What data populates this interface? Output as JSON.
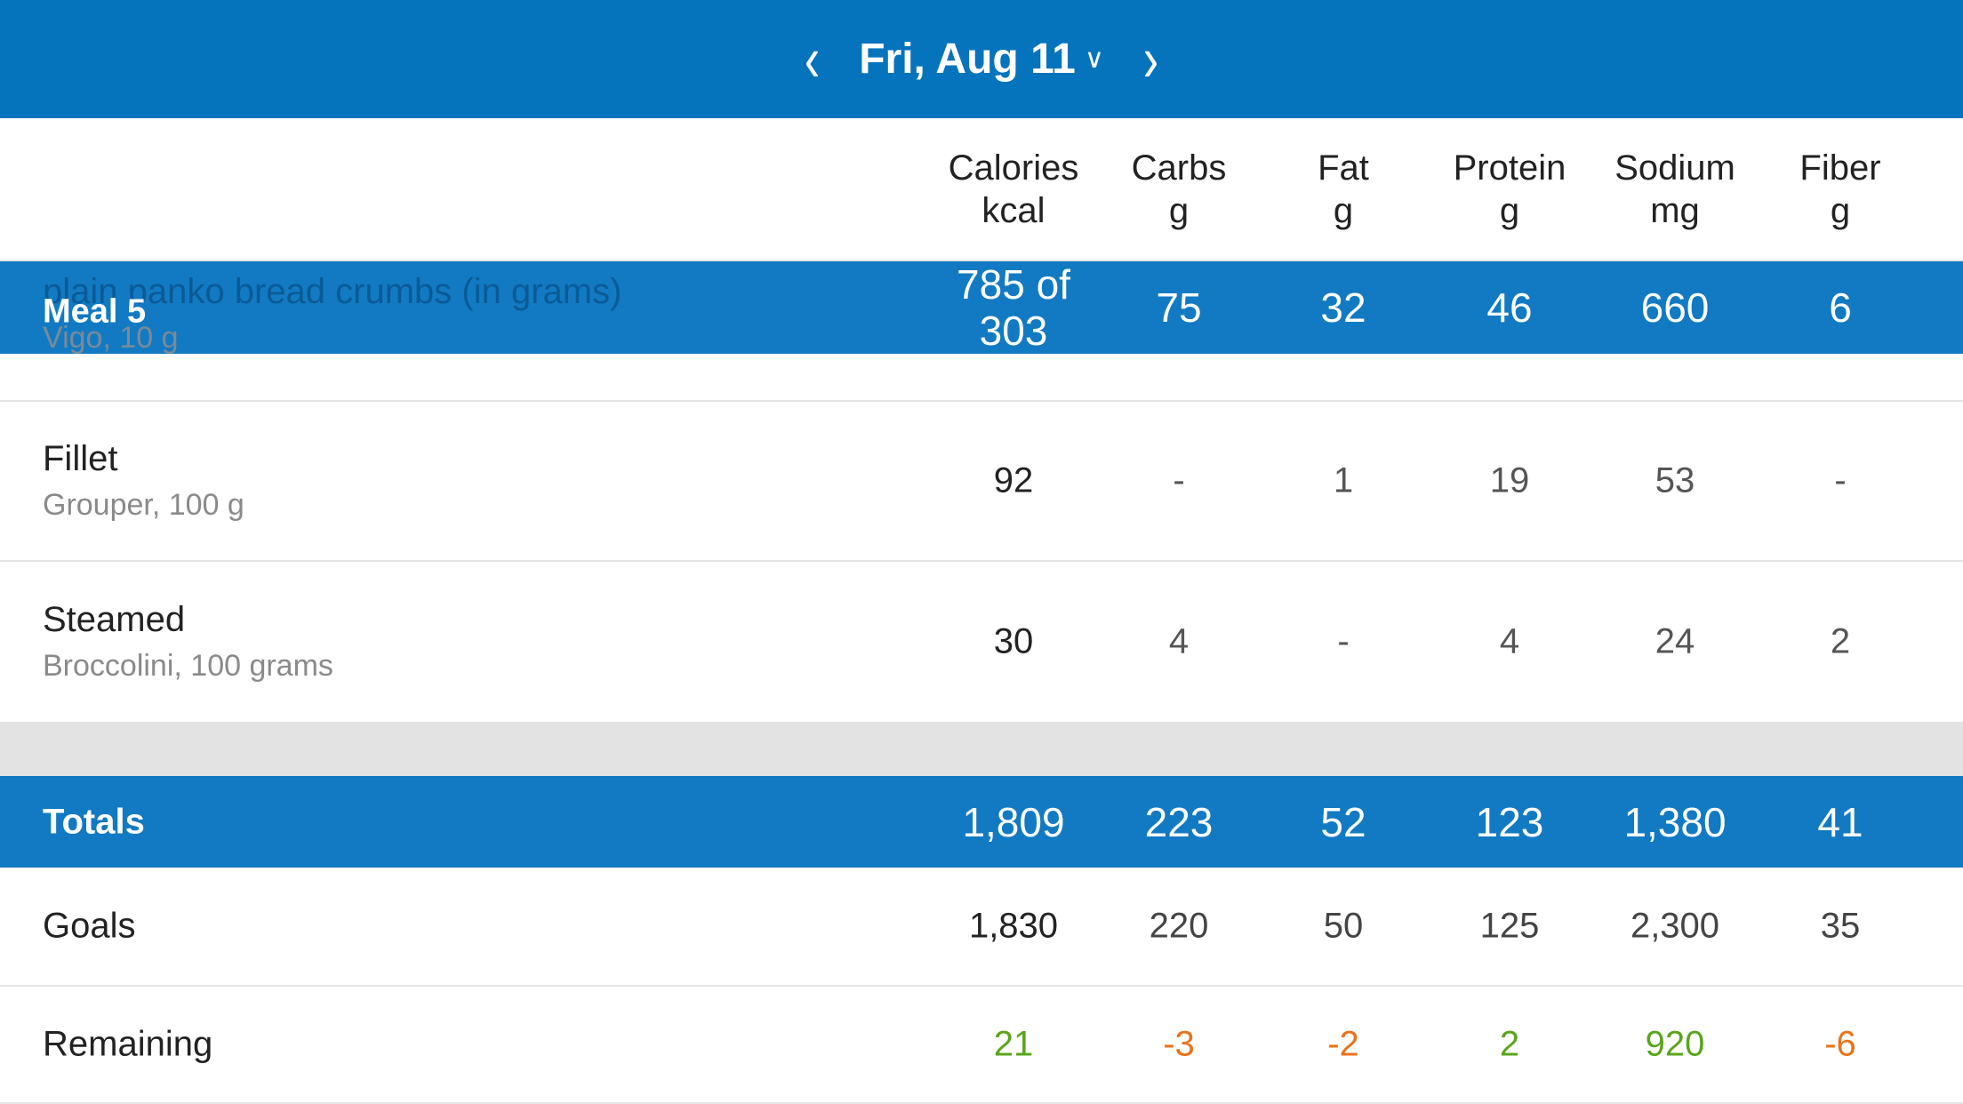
{
  "header": {
    "date": "Fri, Aug 11",
    "prev_icon": "chevron-left-icon",
    "next_icon": "chevron-right-icon",
    "dropdown_icon": "chevron-down-icon"
  },
  "columns": [
    {
      "name": "Calories",
      "unit": "kcal"
    },
    {
      "name": "Carbs",
      "unit": "g"
    },
    {
      "name": "Fat",
      "unit": "g"
    },
    {
      "name": "Protein",
      "unit": "g"
    },
    {
      "name": "Sodium",
      "unit": "mg"
    },
    {
      "name": "Fiber",
      "unit": "g"
    }
  ],
  "scrolled_item": {
    "name": "plain panko bread crumbs (in grams)",
    "detail": "Vigo, 10 g"
  },
  "meal": {
    "label": "Meal 5",
    "calories": "785 of 303",
    "values": [
      "75",
      "32",
      "46",
      "660",
      "6"
    ]
  },
  "foods": [
    {
      "name": "Fillet",
      "detail": "Grouper, 100 g",
      "values": [
        "92",
        "-",
        "1",
        "19",
        "53",
        "-"
      ]
    },
    {
      "name": "Steamed",
      "detail": "Broccolini, 100 grams",
      "values": [
        "30",
        "4",
        "-",
        "4",
        "24",
        "2"
      ]
    }
  ],
  "totals": {
    "label": "Totals",
    "values": [
      "1,809",
      "223",
      "52",
      "123",
      "1,380",
      "41"
    ]
  },
  "goals": {
    "label": "Goals",
    "values": [
      "1,830",
      "220",
      "50",
      "125",
      "2,300",
      "35"
    ]
  },
  "remaining": {
    "label": "Remaining",
    "values": [
      "21",
      "-3",
      "-2",
      "2",
      "920",
      "-6"
    ]
  },
  "colors": {
    "header": "#0673bd",
    "band": "#127ac2",
    "positive": "#5aa51c",
    "negative": "#e8731c"
  }
}
